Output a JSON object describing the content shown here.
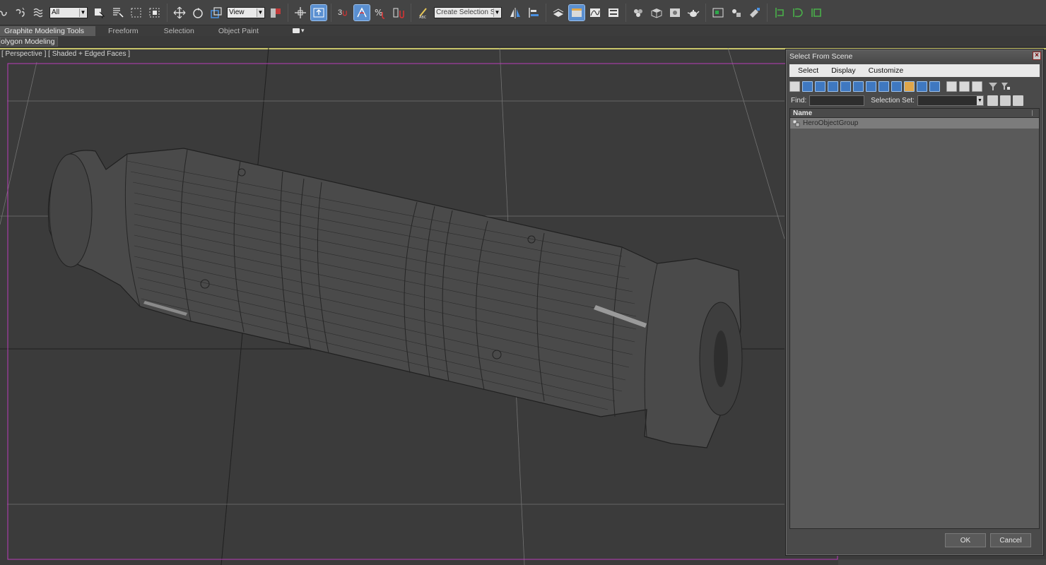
{
  "toolbar": {
    "selection_filter": "All",
    "reference_coord": "View",
    "named_selection": "Create Selection Se",
    "snap_label": "3"
  },
  "ribbon": {
    "tabs": [
      {
        "label": "Graphite Modeling Tools",
        "active": true
      },
      {
        "label": "Freeform",
        "active": false
      },
      {
        "label": "Selection",
        "active": false
      },
      {
        "label": "Object Paint",
        "active": false
      }
    ],
    "panel_label": "olygon Modeling"
  },
  "viewport": {
    "label": "[ Perspective ] [ Shaded + Edged Faces ]",
    "active_border_color": "#c8c46a",
    "safe_frame_color": "#b83db8"
  },
  "dialog": {
    "title": "Select From Scene",
    "menu": [
      "Select",
      "Display",
      "Customize"
    ],
    "find_label": "Find:",
    "find_value": "",
    "selection_set_label": "Selection Set:",
    "selection_set_value": "",
    "column_header": "Name",
    "rows": [
      {
        "name": "HeroObjectGroup",
        "icon": "group-icon",
        "selected": true
      }
    ],
    "ok_label": "OK",
    "cancel_label": "Cancel"
  }
}
